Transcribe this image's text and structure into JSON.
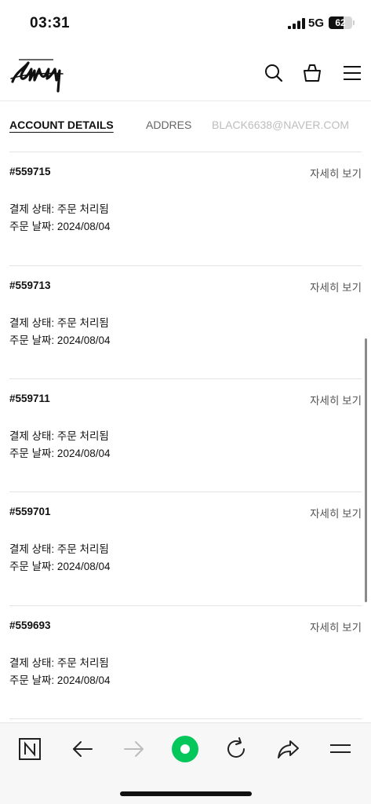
{
  "status_bar": {
    "time": "03:31",
    "network": "5G",
    "battery": "62",
    "battery_level_percent": 62
  },
  "header": {
    "logo_text": "Stüssy",
    "icons": [
      "search-icon",
      "shopping-bag-icon",
      "menu-icon"
    ]
  },
  "tabs": [
    {
      "label": "ACCOUNT DETAILS",
      "active": true
    },
    {
      "label": "ADDRES"
    },
    {
      "label": "BLACK6638@NAVER.COM"
    }
  ],
  "orders": [
    {
      "number": "#559715",
      "detail_label": "자세히 보기",
      "status": "결제 상태: 주문 처리됨",
      "date": "주문 날짜: 2024/08/04"
    },
    {
      "number": "#559713",
      "detail_label": "자세히 보기",
      "status": "결제 상태: 주문 처리됨",
      "date": "주문 날짜: 2024/08/04"
    },
    {
      "number": "#559711",
      "detail_label": "자세히 보기",
      "status": "결제 상태: 주문 처리됨",
      "date": "주문 날짜: 2024/08/04"
    },
    {
      "number": "#559701",
      "detail_label": "자세히 보기",
      "status": "결제 상태: 주문 처리됨",
      "date": "주문 날짜: 2024/08/04"
    },
    {
      "number": "#559693",
      "detail_label": "자세히 보기",
      "status": "결제 상태: 주문 처리됨",
      "date": "주문 날짜: 2024/08/04"
    }
  ],
  "toolbar": {
    "icons": [
      "naver-icon",
      "back-arrow-icon",
      "forward-arrow-icon",
      "green-dot-icon",
      "reload-icon",
      "share-icon",
      "menu-lines-icon"
    ],
    "accent_color": "#03c75a"
  }
}
